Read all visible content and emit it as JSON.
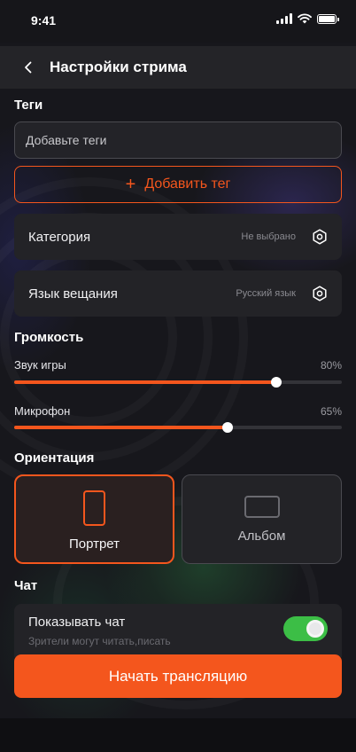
{
  "status_bar": {
    "time": "9:41"
  },
  "header": {
    "title": "Настройки стрима"
  },
  "tags": {
    "title": "Теги",
    "input_placeholder": "Добавьте теги",
    "add_button_label": "Добавить тег"
  },
  "settings": [
    {
      "label": "Категория",
      "value": "Не выбрано",
      "icon": "hexagon-settings-icon"
    },
    {
      "label": "Язык вещания",
      "value": "Русский язык",
      "icon": "hexagon-settings-icon"
    }
  ],
  "volume": {
    "title": "Громкость",
    "sliders": [
      {
        "label": "Звук игры",
        "value_text": "80%",
        "value": 0.8
      },
      {
        "label": "Микрофон",
        "value_text": "65%",
        "value": 0.65
      }
    ]
  },
  "orientation": {
    "title": "Ориентация",
    "options": [
      {
        "label": "Портрет",
        "selected": true
      },
      {
        "label": "Альбом",
        "selected": false
      }
    ]
  },
  "chat": {
    "title": "Чат",
    "toggle_label": "Показывать чат",
    "toggle_subtitle": "Зрители могут читать,писать",
    "enabled": true
  },
  "start_button_label": "Начать трансляцию",
  "colors": {
    "accent": "#f4561d",
    "toggle_on": "#3cbe46",
    "background": "#17171c",
    "card": "#232327"
  }
}
